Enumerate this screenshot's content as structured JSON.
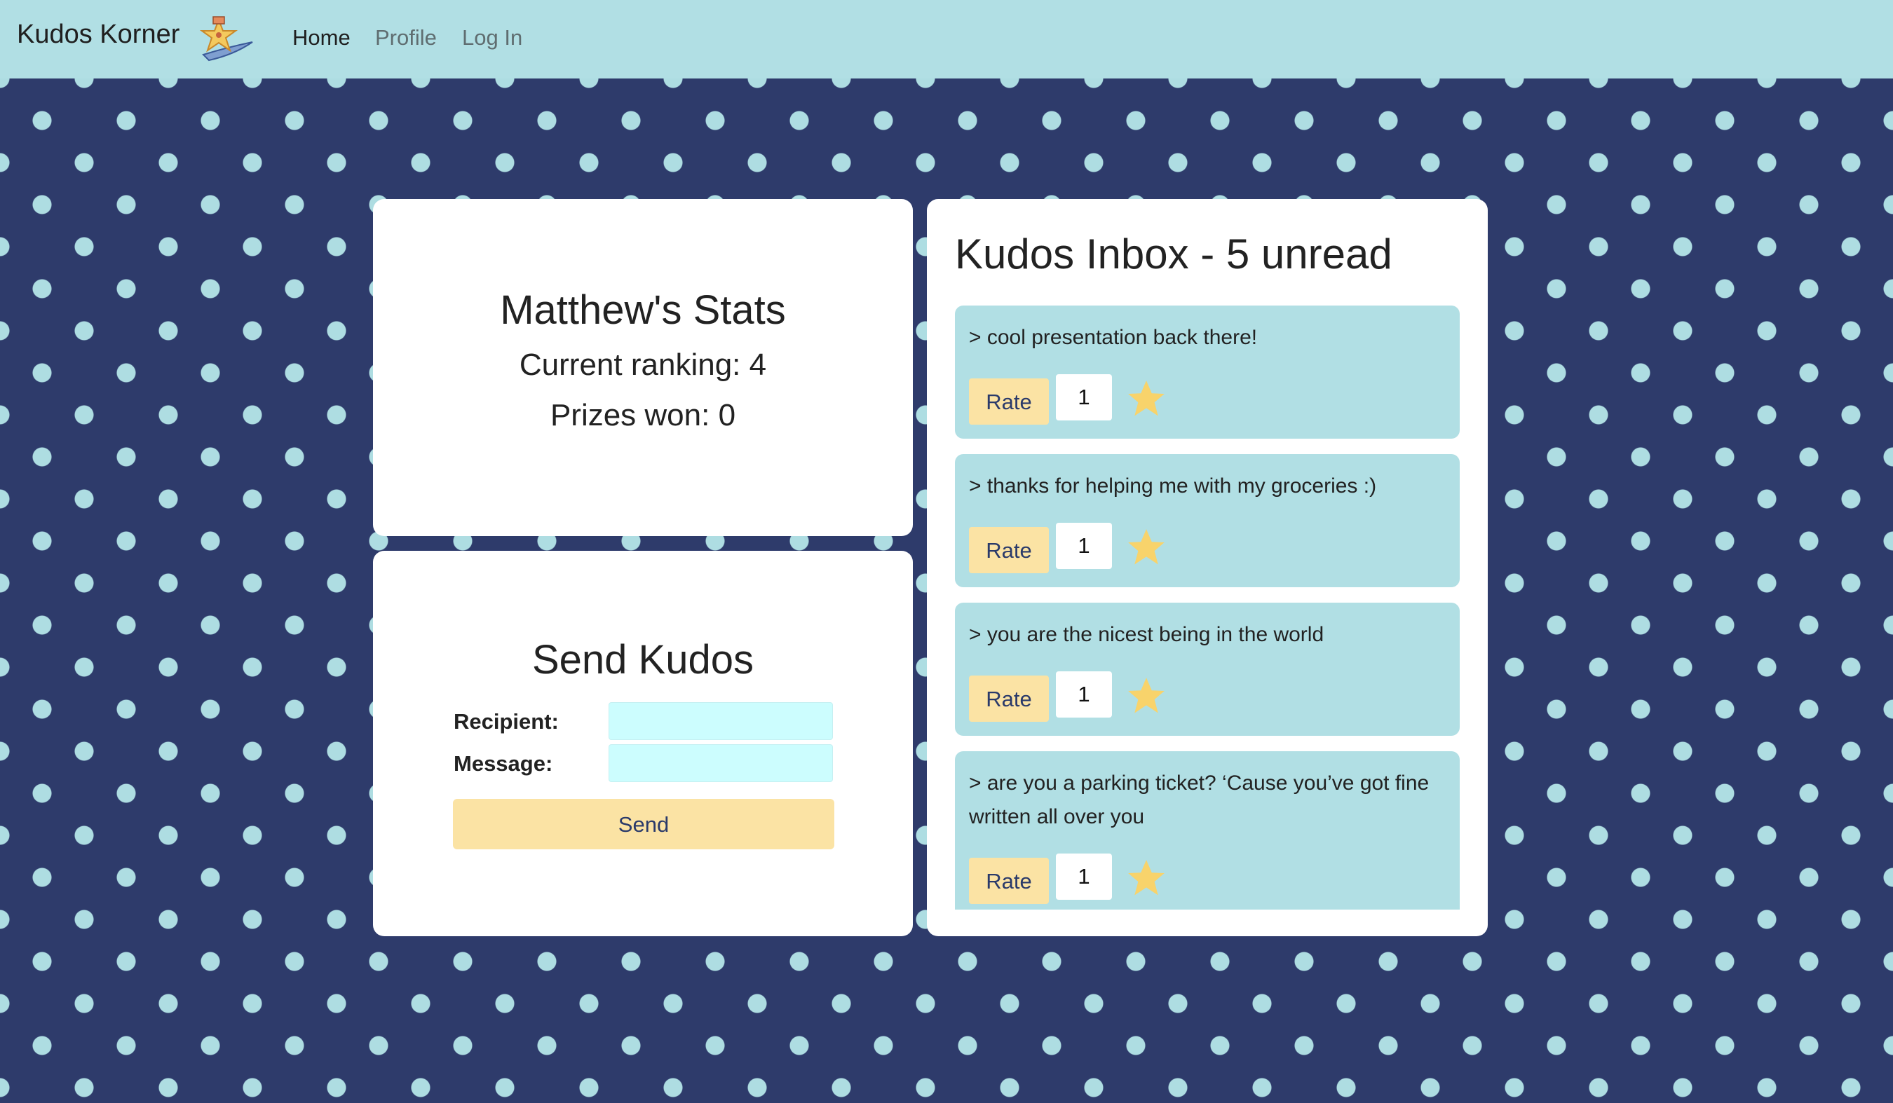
{
  "navbar": {
    "brand": "Kudos Korner",
    "links": [
      {
        "label": "Home"
      },
      {
        "label": "Profile"
      },
      {
        "label": "Log In"
      }
    ]
  },
  "stats": {
    "title": "Matthew's Stats",
    "ranking": "Current ranking: 4",
    "prizes": "Prizes won: 0"
  },
  "send": {
    "title": "Send Kudos",
    "recipient_label": "Recipient:",
    "recipient_value": "",
    "message_label": "Message:",
    "message_value": "",
    "send_label": "Send"
  },
  "inbox": {
    "title": "Kudos Inbox - 5 unread",
    "messages": [
      {
        "text": "> cool presentation back there!",
        "rate_label": "Rate",
        "rating": "1"
      },
      {
        "text": "> thanks for helping me with my groceries :)",
        "rate_label": "Rate",
        "rating": "1"
      },
      {
        "text": "> you are the nicest being in the world",
        "rate_label": "Rate",
        "rating": "1"
      },
      {
        "text": "> are you a parking ticket? ‘Cause you’ve got fine written all over you",
        "rate_label": "Rate",
        "rating": "1"
      }
    ]
  },
  "colors": {
    "navbar": "#b1dfe4",
    "background": "#2e3b6b",
    "dots": "#aedde2",
    "accent_button": "#fbe3a4",
    "input": "#ccfdfe",
    "star": "#f8d36b"
  }
}
